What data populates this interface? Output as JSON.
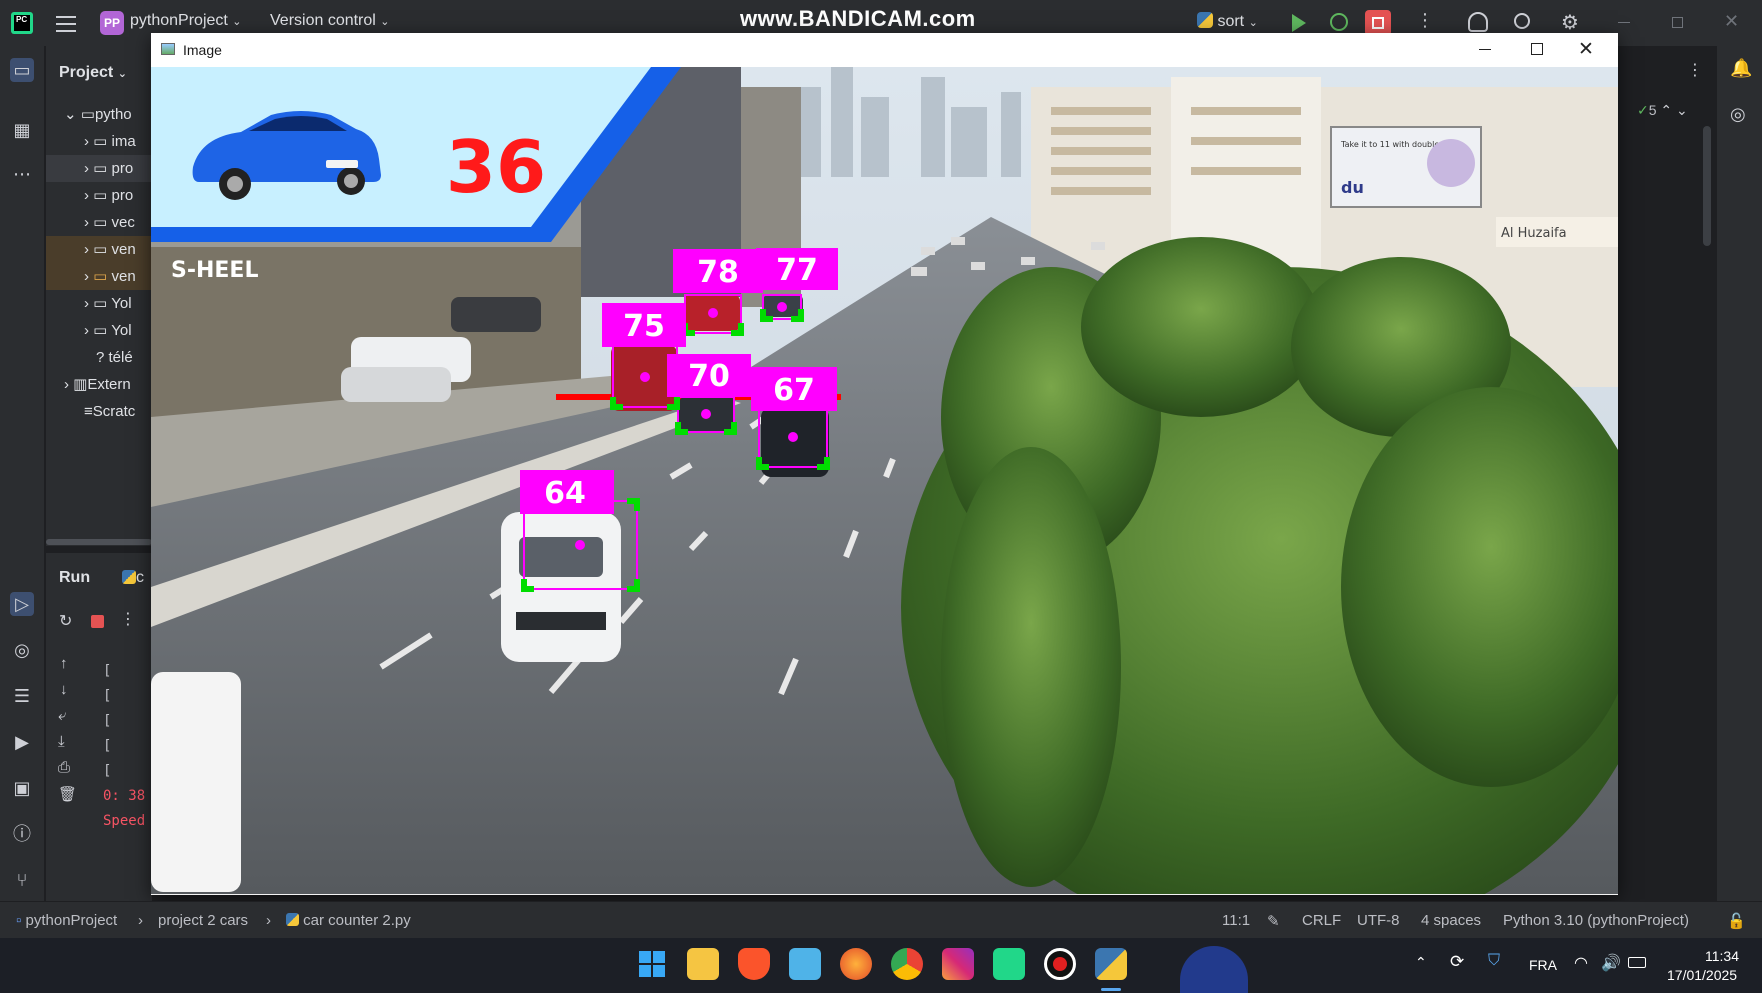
{
  "ide": {
    "project_badge": "PP",
    "project_name": "pythonProject",
    "version_control": "Version control",
    "run_config": "sort",
    "watermark": "www.BANDICAM.com",
    "project_panel_title": "Project",
    "tree": [
      {
        "label": "pytho",
        "kind": "folder-open"
      },
      {
        "label": "ima",
        "kind": "folder"
      },
      {
        "label": "pro",
        "kind": "folder"
      },
      {
        "label": "pro",
        "kind": "folder"
      },
      {
        "label": "vec",
        "kind": "folder"
      },
      {
        "label": "ven",
        "kind": "folder"
      },
      {
        "label": "ven",
        "kind": "folder"
      },
      {
        "label": "Yol",
        "kind": "folder"
      },
      {
        "label": "Yol",
        "kind": "folder"
      },
      {
        "label": "télé",
        "kind": "file"
      },
      {
        "label": "Extern",
        "kind": "lib"
      },
      {
        "label": "Scratc",
        "kind": "scratch"
      }
    ],
    "run_panel_title": "Run",
    "run_tab": "c",
    "console_lines": [
      "[",
      "[",
      "[",
      "[",
      "[",
      "0: 38",
      "Speed"
    ],
    "right_indicator": "5"
  },
  "image_window": {
    "title": "Image",
    "count_display": "36",
    "billboard_text": "Take it to 11 with double data.",
    "billboard_brand": "du",
    "shop_sign": "S-HEEL",
    "building_sign": "Al Huzaifa",
    "tracked_ids": [
      "78",
      "77",
      "75",
      "70",
      "67",
      "64"
    ],
    "colors": {
      "label_bg": "#ff00ff",
      "box_corner": "#00dd00",
      "count_line": "#ff0000",
      "count_text": "#ff1a1a",
      "panel_bg": "#c8f0ff",
      "panel_border": "#1560e8"
    }
  },
  "statusbar": {
    "crumb_project": "pythonProject",
    "crumb_folder": "project 2 cars",
    "crumb_file": "car counter 2.py",
    "position": "11:1",
    "line_sep": "CRLF",
    "encoding": "UTF-8",
    "indent": "4 spaces",
    "interpreter": "Python 3.10 (pythonProject)"
  },
  "taskbar": {
    "language": "FRA",
    "time": "11:34",
    "date": "17/01/2025"
  }
}
